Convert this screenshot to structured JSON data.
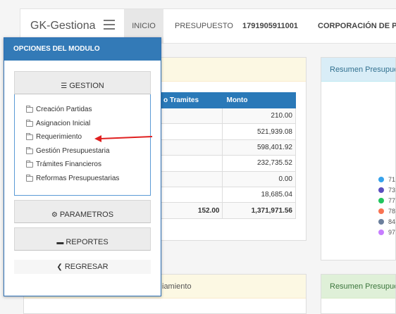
{
  "navbar": {
    "brand": "GK-Gestiona",
    "items": [
      {
        "label": "INICIO"
      },
      {
        "label": "PRESUPUESTO"
      },
      {
        "label": "1791905911001"
      },
      {
        "label": "CORPORACIÓN DE PR"
      }
    ]
  },
  "panels": {
    "top_right_title": "Resumen Presupues",
    "bottom_left_title": "iamiento",
    "bottom_right_title": "Resumen Presupues"
  },
  "table": {
    "headers": [
      "o Tramites",
      "Monto"
    ],
    "rows": [
      {
        "tramites": "",
        "monto": "210.00"
      },
      {
        "tramites": "",
        "monto": "521,939.08"
      },
      {
        "tramites": "",
        "monto": "598,401.92"
      },
      {
        "tramites": "",
        "monto": "232,735.52"
      },
      {
        "tramites": "",
        "monto": "0.00"
      },
      {
        "tramites": "",
        "monto": "18,685.04"
      }
    ],
    "total": {
      "tramites": "152.00",
      "monto": "1,371,971.56"
    }
  },
  "legend": {
    "items": [
      {
        "label": "71",
        "color": "#36a2eb"
      },
      {
        "label": "73",
        "color": "#5b4fbe"
      },
      {
        "label": "77",
        "color": "#22c55e"
      },
      {
        "label": "78",
        "color": "#f97352"
      },
      {
        "label": "84",
        "color": "#6b7f9c"
      },
      {
        "label": "97",
        "color": "#c77dff"
      }
    ]
  },
  "modal": {
    "title": "OPCIONES DEL MODULO",
    "gestion_label": "GESTION",
    "gestion_items": [
      {
        "label": "Creación Partidas"
      },
      {
        "label": "Asignacion Inicial"
      },
      {
        "label": "Requerimiento"
      },
      {
        "label": "Gestión Presupuestaria"
      },
      {
        "label": "Trámites Financieros"
      },
      {
        "label": "Reformas Presupuestarias"
      }
    ],
    "parametros_label": "PARAMETROS",
    "reportes_label": "REPORTES",
    "regresar_label": "REGRESAR"
  },
  "colors": {
    "modal_header": "#337ab7",
    "table_header": "#2a79b8",
    "annotation_arrow": "#e02020"
  }
}
